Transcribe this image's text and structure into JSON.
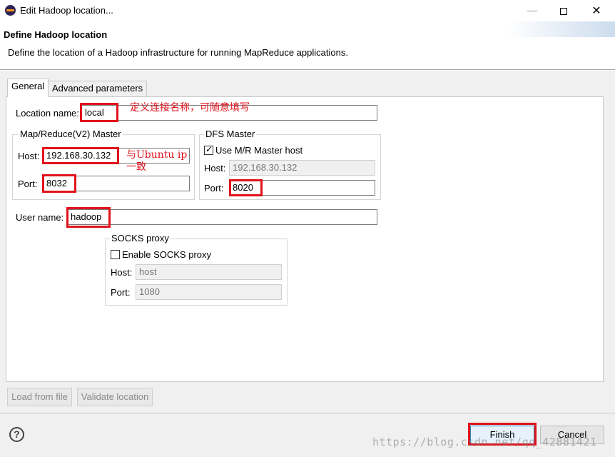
{
  "window": {
    "title": "Edit Hadoop location...",
    "minimize": "—",
    "close": "✕"
  },
  "header": {
    "title": "Define Hadoop location",
    "description": "Define the location of a Hadoop infrastructure for running MapReduce applications."
  },
  "tabs": [
    {
      "label": "General",
      "active": true
    },
    {
      "label": "Advanced parameters",
      "active": false
    }
  ],
  "general": {
    "location_name_label": "Location name:",
    "location_name_value": "local",
    "mr_master": {
      "title": "Map/Reduce(V2) Master",
      "host_label": "Host:",
      "host_value": "192.168.30.132",
      "port_label": "Port:",
      "port_value": "8032"
    },
    "dfs_master": {
      "title": "DFS Master",
      "use_mr_label": "Use M/R Master host",
      "use_mr_checked": true,
      "host_label": "Host:",
      "host_value": "192.168.30.132",
      "port_label": "Port:",
      "port_value": "8020"
    },
    "user_name_label": "User name:",
    "user_name_value": "hadoop",
    "socks": {
      "title": "SOCKS proxy",
      "enable_label": "Enable SOCKS proxy",
      "enable_checked": false,
      "host_label": "Host:",
      "host_value": "host",
      "port_label": "Port:",
      "port_value": "1080"
    }
  },
  "annotations": {
    "location_note": "定义连接名称，可随意填写",
    "host_note_line1": "与Ubuntu ip",
    "host_note_line2": "一致",
    "accent_color": "#e1121b"
  },
  "buttons": {
    "load_from_file": "Load from file",
    "validate_location": "Validate location",
    "finish": "Finish",
    "cancel": "Cancel",
    "help": "?"
  },
  "watermark": "https://blog.csdn.net/qq_42881421"
}
